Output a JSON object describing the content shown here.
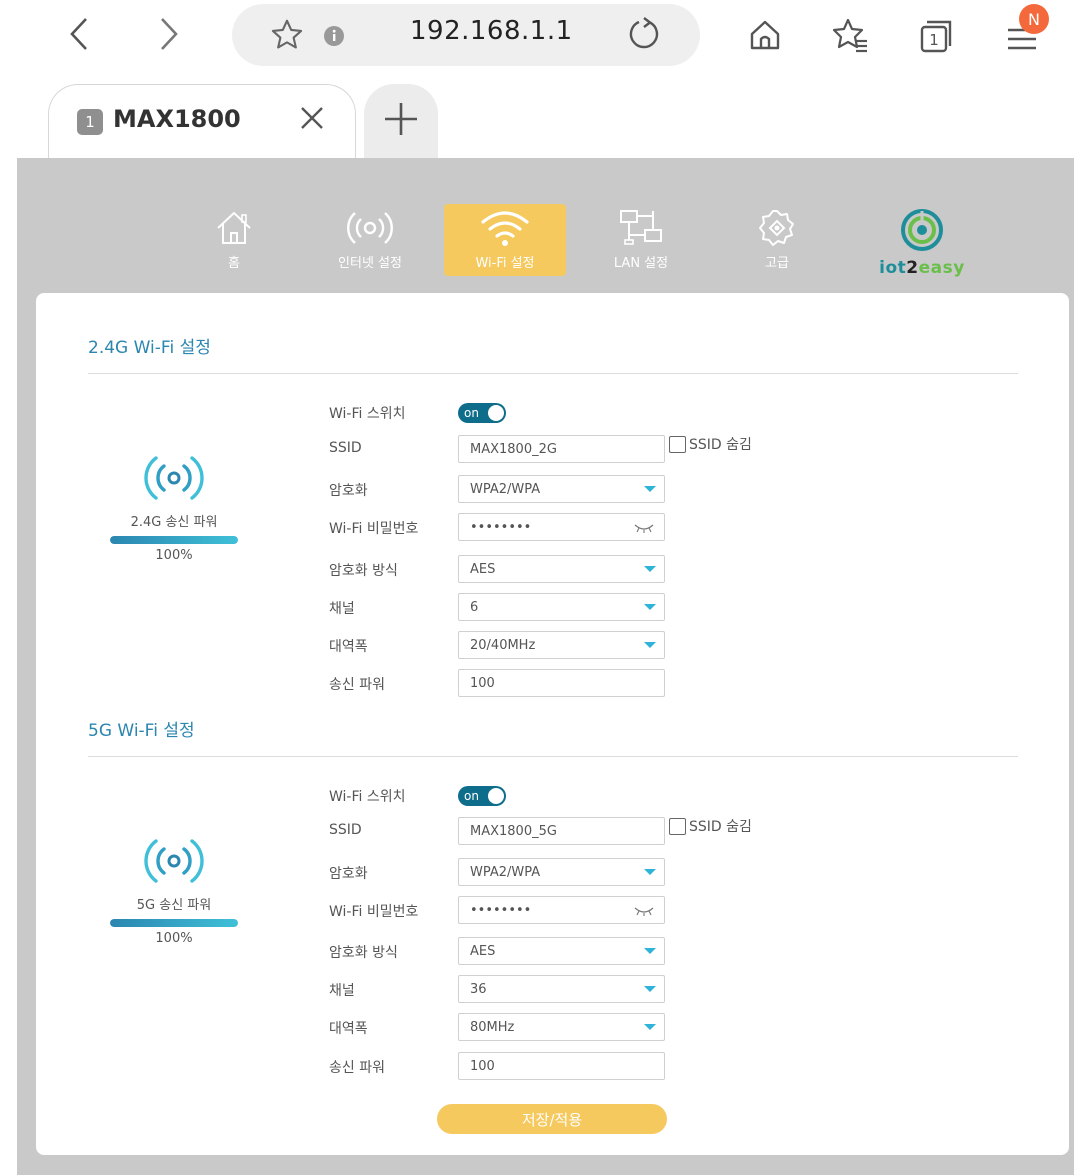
{
  "browser": {
    "url": "192.168.1.1",
    "tab_count": "1",
    "notification_badge": "N",
    "tab": {
      "number": "1",
      "title": "MAX1800"
    }
  },
  "nav": {
    "items": [
      {
        "label": "홈",
        "icon": "home-icon"
      },
      {
        "label": "인터넷 설정",
        "icon": "broadcast-icon"
      },
      {
        "label": "Wi-Fi 설정",
        "icon": "wifi-icon",
        "active": true
      },
      {
        "label": "LAN 설정",
        "icon": "network-icon"
      },
      {
        "label": "고급",
        "icon": "gear-icon"
      }
    ],
    "brand": {
      "part1": "iot",
      "part2": "2",
      "part3": "easy"
    }
  },
  "labels": {
    "wifi_switch": "Wi-Fi 스위치",
    "ssid": "SSID",
    "encryption": "암호화",
    "password": "Wi-Fi 비밀번호",
    "cipher": "암호화 방식",
    "channel": "채널",
    "bandwidth": "대역폭",
    "tx_power": "송신 파워",
    "ssid_hide": "SSID 숨김",
    "toggle_on": "on"
  },
  "wifi24": {
    "title": "2.4G Wi-Fi 설정",
    "power_label": "2.4G 송신 파워",
    "power_percent": "100%",
    "power_level": 1.0,
    "ssid": "MAX1800_2G",
    "encryption": "WPA2/WPA",
    "password": "••••••••",
    "cipher": "AES",
    "channel": "6",
    "bandwidth": "20/40MHz",
    "tx_power": "100"
  },
  "wifi5": {
    "title": "5G Wi-Fi 설정",
    "power_label": "5G 송신 파워",
    "power_percent": "100%",
    "power_level": 1.0,
    "ssid": "MAX1800_5G",
    "encryption": "WPA2/WPA",
    "password": "••••••••",
    "cipher": "AES",
    "channel": "36",
    "bandwidth": "80MHz",
    "tx_power": "100"
  },
  "save_label": "저장/적용",
  "colors": {
    "accent_yellow": "#f5c95d",
    "title_blue": "#2b86b0",
    "toggle_blue": "#0f6d8c",
    "caret_cyan": "#2fb3d6",
    "badge_orange": "#f4693b"
  }
}
